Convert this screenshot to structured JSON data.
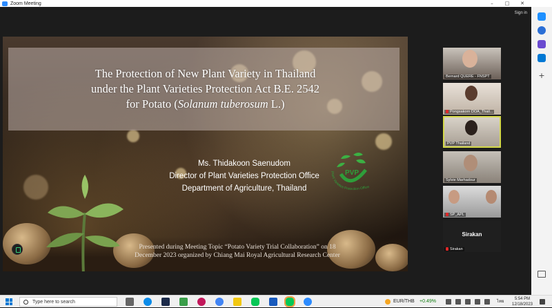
{
  "window": {
    "title": "Zoom Meeting",
    "sign_in": "Sign in"
  },
  "slide": {
    "title_lines": [
      "The Protection of New Plant Variety in Thailand",
      "under the Plant Varieties Protection Act B.E. 2542"
    ],
    "title_line3_prefix": "for Potato (",
    "title_line3_italic": "Solanum tuberosum",
    "title_line3_suffix": " L.)",
    "speaker_name": "Ms. Thidakoon Saenudom",
    "speaker_role": "Director of Plant Varieties Protection Office",
    "speaker_org": "Department of Agriculture, Thailand",
    "logo_text": "PVP",
    "logo_arc_text": "Plant Varieties Protection Office",
    "footer_lines": [
      "Presented during Meeting Topic “Potato Variety Trial Collaboration” on 18",
      "December 2023 organized by Chiang Mai Royal Agricultural Research Center"
    ]
  },
  "participants": [
    {
      "name": "Bernard QUERE - FNSPT",
      "muted": false,
      "active": false
    },
    {
      "name": "Pongsakorn DOA_Thail...",
      "muted": true,
      "active": false
    },
    {
      "name": "PVP Thailand",
      "muted": false,
      "active": true
    },
    {
      "name": "Sylvie Marhadour",
      "muted": false,
      "active": false
    },
    {
      "name": "SP_APL",
      "muted": true,
      "active": false
    },
    {
      "name": "Sirakan",
      "muted": true,
      "active": false,
      "display_name": "Sirakan"
    }
  ],
  "taskbar": {
    "search_placeholder": "Type here to search",
    "ticker_symbol": "EUR/THB",
    "ticker_change": "+0.49%",
    "lang": "ไทย",
    "time": "5:54 PM",
    "date": "12/18/2023"
  },
  "colors": {
    "zoom_blue": "#2d8cff",
    "active_speaker": "#d4d94a",
    "ticker_green": "#107c10",
    "muted_red": "#e02828",
    "pvp_green": "#2e9e3a"
  }
}
